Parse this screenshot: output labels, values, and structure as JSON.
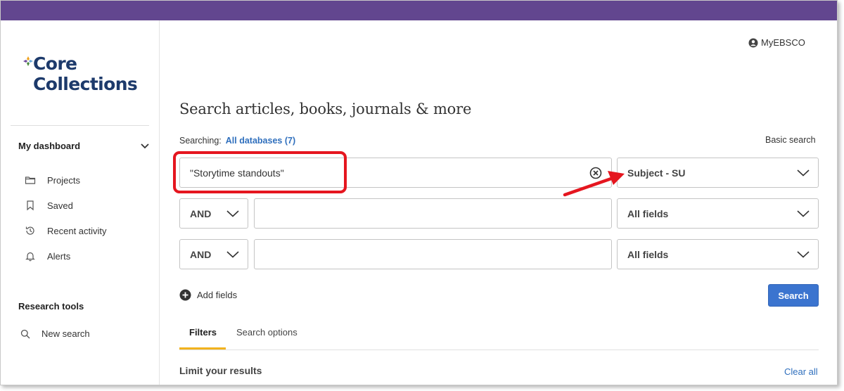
{
  "brand": {
    "line1": "Core",
    "line2": "Collections"
  },
  "account": {
    "label": "MyEBSCO"
  },
  "sidebar": {
    "dashboard_label": "My dashboard",
    "items": [
      {
        "label": "Projects",
        "icon": "folder-icon"
      },
      {
        "label": "Saved",
        "icon": "bookmark-icon"
      },
      {
        "label": "Recent activity",
        "icon": "history-icon"
      },
      {
        "label": "Alerts",
        "icon": "bell-icon"
      }
    ],
    "research_tools_label": "Research tools",
    "new_search_label": "New search"
  },
  "main": {
    "title": "Search articles, books, journals & more",
    "searching_label": "Searching:",
    "databases_link": "All databases (7)",
    "basic_search_label": "Basic search",
    "rows": [
      {
        "operator": "",
        "query": "\"Storytime standouts\"",
        "field": "Subject - SU"
      },
      {
        "operator": "AND",
        "query": "",
        "field": "All fields"
      },
      {
        "operator": "AND",
        "query": "",
        "field": "All fields"
      }
    ],
    "add_fields_label": "Add fields",
    "search_button": "Search",
    "tabs": [
      {
        "label": "Filters",
        "active": true
      },
      {
        "label": "Search options",
        "active": false
      }
    ],
    "limit_label": "Limit your results",
    "clear_all_label": "Clear all"
  },
  "colors": {
    "top_bar": "#62468f",
    "brand_text": "#1d3a6b",
    "link": "#2f6fbd",
    "primary_button": "#3b74cf",
    "active_tab_underline": "#f2b21e",
    "annotation_red": "#e5161f"
  }
}
